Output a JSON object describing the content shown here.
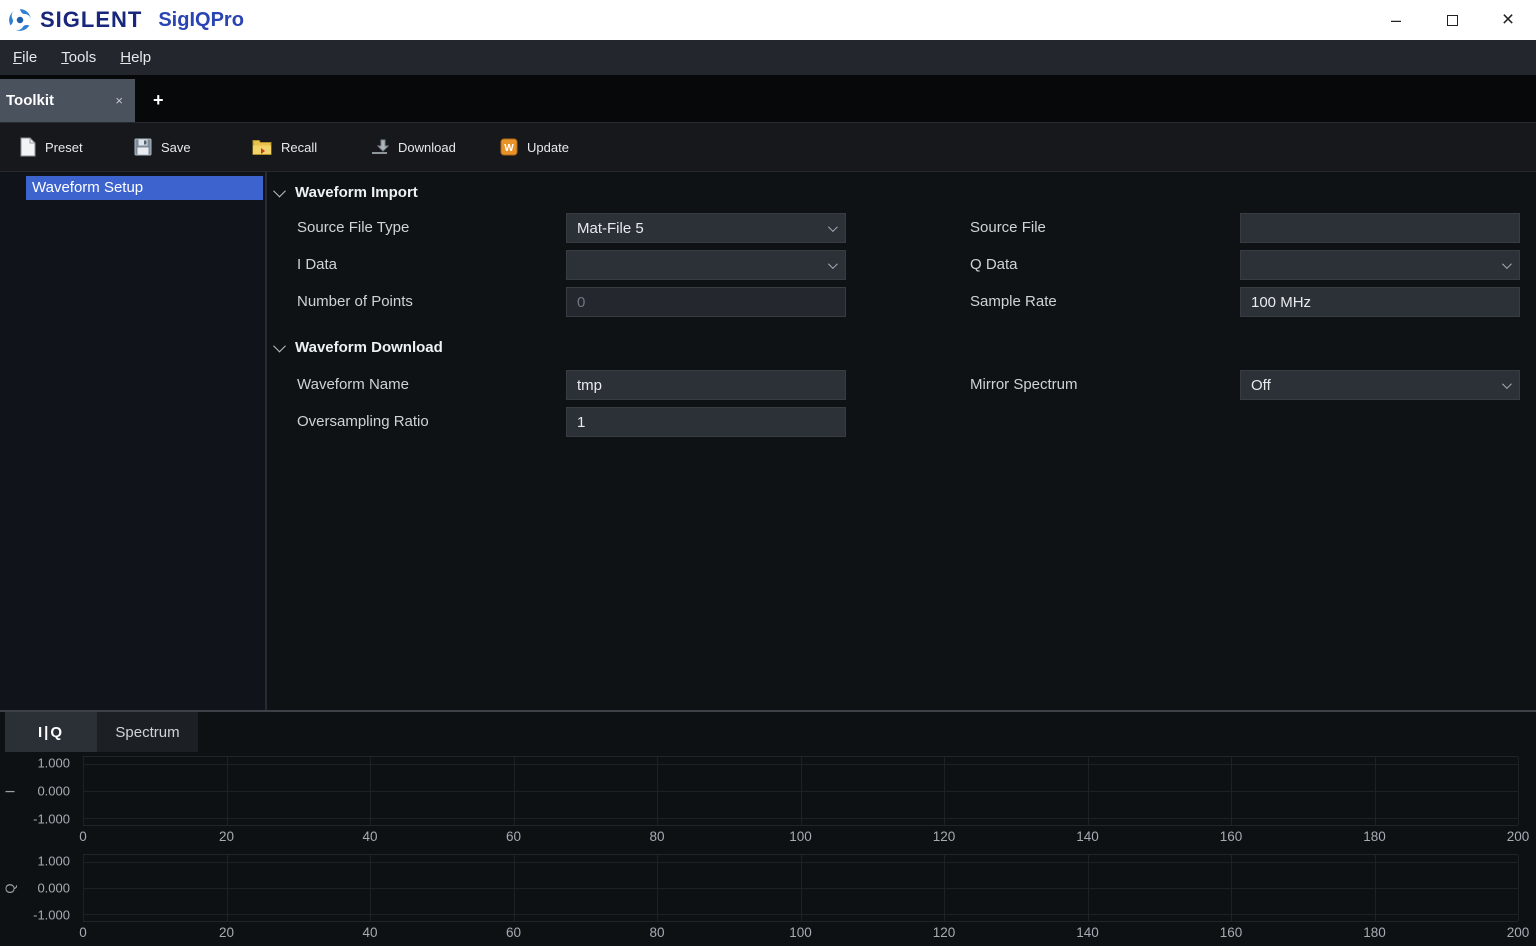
{
  "titlebar": {
    "brand": "SIGLENT",
    "app_name": "SigIQPro",
    "minimize_glyph": "–",
    "close_glyph": "×"
  },
  "menubar": {
    "items": [
      {
        "label": "File"
      },
      {
        "label": "Tools"
      },
      {
        "label": "Help"
      }
    ]
  },
  "tabbar": {
    "active_tab": "Toolkit",
    "tab_close_glyph": "×",
    "add_tab_glyph": "+"
  },
  "toolbar": {
    "buttons": [
      {
        "label": "Preset",
        "icon": "document-icon"
      },
      {
        "label": "Save",
        "icon": "floppy-icon"
      },
      {
        "label": "Recall",
        "icon": "folder-icon"
      },
      {
        "label": "Download",
        "icon": "download-icon"
      },
      {
        "label": "Update",
        "icon": "update-icon"
      }
    ]
  },
  "sidebar": {
    "selected_item": "Waveform Setup"
  },
  "form": {
    "import_title": "Waveform Import",
    "download_title": "Waveform Download",
    "source_file_type_label": "Source File Type",
    "source_file_type_value": "Mat-File 5",
    "source_file_label": "Source File",
    "source_file_value": "",
    "i_data_label": "I Data",
    "i_data_value": "",
    "q_data_label": "Q Data",
    "q_data_value": "",
    "number_of_points_label": "Number of Points",
    "number_of_points_value": "0",
    "sample_rate_label": "Sample Rate",
    "sample_rate_value": "100 MHz",
    "waveform_name_label": "Waveform Name",
    "waveform_name_value": "tmp",
    "mirror_spectrum_label": "Mirror Spectrum",
    "mirror_spectrum_value": "Off",
    "oversampling_ratio_label": "Oversampling Ratio",
    "oversampling_ratio_value": "1"
  },
  "bottom_panel": {
    "tabs": [
      {
        "label": "I|Q",
        "active": true
      },
      {
        "label": "Spectrum",
        "active": false
      }
    ]
  },
  "chart_data": [
    {
      "type": "line",
      "axis_label": "I",
      "x_ticks": [
        0,
        20,
        40,
        60,
        80,
        100,
        120,
        140,
        160,
        180,
        200
      ],
      "y_ticks": [
        "1.000",
        "0.000",
        "-1.000"
      ],
      "xlim": [
        0,
        200
      ],
      "ylim": [
        -1,
        1
      ],
      "grid": true,
      "series": []
    },
    {
      "type": "line",
      "axis_label": "Q",
      "x_ticks": [
        0,
        20,
        40,
        60,
        80,
        100,
        120,
        140,
        160,
        180,
        200
      ],
      "y_ticks": [
        "1.000",
        "0.000",
        "-1.000"
      ],
      "xlim": [
        0,
        200
      ],
      "ylim": [
        -1,
        1
      ],
      "grid": true,
      "series": []
    }
  ],
  "colors": {
    "selection_blue": "#3d63cf",
    "brand_blue": "#18277c",
    "app_name_blue": "#2b44b4",
    "update_icon_orange": "#e8922a",
    "folder_icon_yellow": "#e8c24a"
  }
}
